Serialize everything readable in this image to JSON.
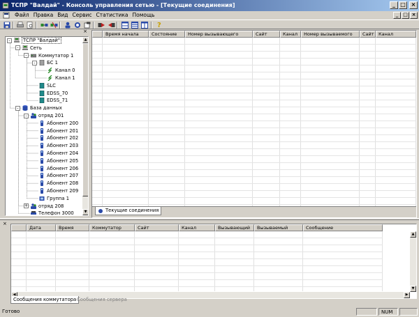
{
  "window": {
    "title": "ТСПР \"Валдай\" - Консоль управления сетью - [Текущие соединения]",
    "title_color": "#0a246a",
    "buttons": [
      "_",
      "□",
      "×"
    ],
    "mdi_buttons": [
      "_",
      "□",
      "×"
    ]
  },
  "menu": [
    {
      "label": "Файл",
      "icon": "none"
    },
    {
      "label": "Правка"
    },
    {
      "label": "Вид"
    },
    {
      "label": "Сервис"
    },
    {
      "label": "Статистика"
    },
    {
      "label": "Помощь"
    }
  ],
  "toolbar": {
    "buttons": [
      {
        "icon": "save-icon",
        "color": "#2a4aa8"
      },
      {
        "icon": "print-icon",
        "color": "#808080"
      },
      {
        "icon": "print-preview-icon",
        "color": "#808080"
      },
      {
        "icon": "network-connect-icon",
        "color": "#2a4aa8"
      },
      {
        "icon": "network-disconnect-icon",
        "color": "#2a4aa8"
      },
      {
        "icon": "user-find-icon",
        "color": "#2a4aa8"
      },
      {
        "icon": "refresh-icon",
        "color": "#2a4aa8"
      },
      {
        "icon": "new-window-icon",
        "color": "#404040"
      },
      {
        "icon": "arrow-right-icon",
        "color": "#a02020"
      },
      {
        "icon": "arrow-left-icon",
        "color": "#a02020"
      },
      {
        "icon": "split-horizontal-icon",
        "color": "#2a4aa8"
      },
      {
        "icon": "split-horizontal-2-icon",
        "color": "#2a4aa8"
      },
      {
        "icon": "split-vertical-icon",
        "color": "#2a4aa8"
      },
      {
        "icon": "help-icon",
        "color": "#c8a000"
      }
    ]
  },
  "tree": {
    "close": "×",
    "items": [
      {
        "label": "ТСПР \"Валдай\"",
        "icon": "network-icon",
        "level": 0,
        "expander": "-",
        "selected": true
      },
      {
        "label": "Сеть",
        "icon": "network-icon",
        "level": 1,
        "expander": "-"
      },
      {
        "label": "Коммутатор 1",
        "icon": "switch-icon",
        "level": 2,
        "expander": "-"
      },
      {
        "label": "БС 1",
        "icon": "base-station-icon",
        "level": 3,
        "expander": "-"
      },
      {
        "label": "Канал 0",
        "icon": "channel-icon",
        "level": 4
      },
      {
        "label": "Канал 1",
        "icon": "channel-icon",
        "level": 4
      },
      {
        "label": "SLC",
        "icon": "module-icon",
        "level": 3
      },
      {
        "label": "EDSS_70",
        "icon": "module-icon",
        "level": 3
      },
      {
        "label": "EDSS_71",
        "icon": "module-icon",
        "level": 3
      },
      {
        "label": "База данных",
        "icon": "database-icon",
        "level": 1,
        "expander": "-"
      },
      {
        "label": "отряд 201",
        "icon": "group-icon",
        "level": 2,
        "expander": "-"
      },
      {
        "label": "Абонент 200",
        "icon": "subscriber-icon",
        "level": 3
      },
      {
        "label": "Абонент 201",
        "icon": "subscriber-icon",
        "level": 3
      },
      {
        "label": "Абонент 202",
        "icon": "subscriber-icon",
        "level": 3
      },
      {
        "label": "Абонент 203",
        "icon": "subscriber-icon",
        "level": 3
      },
      {
        "label": "Абонент 204",
        "icon": "subscriber-icon",
        "level": 3
      },
      {
        "label": "Абонент 205",
        "icon": "subscriber-icon",
        "level": 3
      },
      {
        "label": "Абонент 206",
        "icon": "subscriber-icon",
        "level": 3
      },
      {
        "label": "Абонент 207",
        "icon": "subscriber-icon",
        "level": 3
      },
      {
        "label": "Абонент 208",
        "icon": "subscriber-icon",
        "level": 3
      },
      {
        "label": "Абонент 209",
        "icon": "subscriber-icon",
        "level": 3
      },
      {
        "label": "Группа 1",
        "icon": "group-small-icon",
        "level": 3
      },
      {
        "label": "отряд 208",
        "icon": "group-icon",
        "level": 2,
        "expander": "+"
      },
      {
        "label": "Телефон 3000",
        "icon": "phone-icon",
        "level": 2
      }
    ]
  },
  "connections": {
    "columns": [
      "",
      "Время начала",
      "Состояние",
      "Номер вызывающего",
      "Сайт",
      "Канал",
      "Номер вызываемого",
      "Сайт",
      "Канал"
    ],
    "rows": [],
    "tab": "Текущие соединения"
  },
  "messages": {
    "close": "×",
    "columns": [
      "",
      "Дата",
      "Время",
      "Коммутатор",
      "Сайт",
      "Канал",
      "Вызывающий",
      "Вызываемый",
      "Сообщение"
    ],
    "rows": [],
    "tabs": [
      "Сообщения коммутатора",
      "Сообщения сервера"
    ]
  },
  "status": {
    "text": "Готово",
    "indicators": [
      "",
      "NUM",
      ""
    ]
  }
}
